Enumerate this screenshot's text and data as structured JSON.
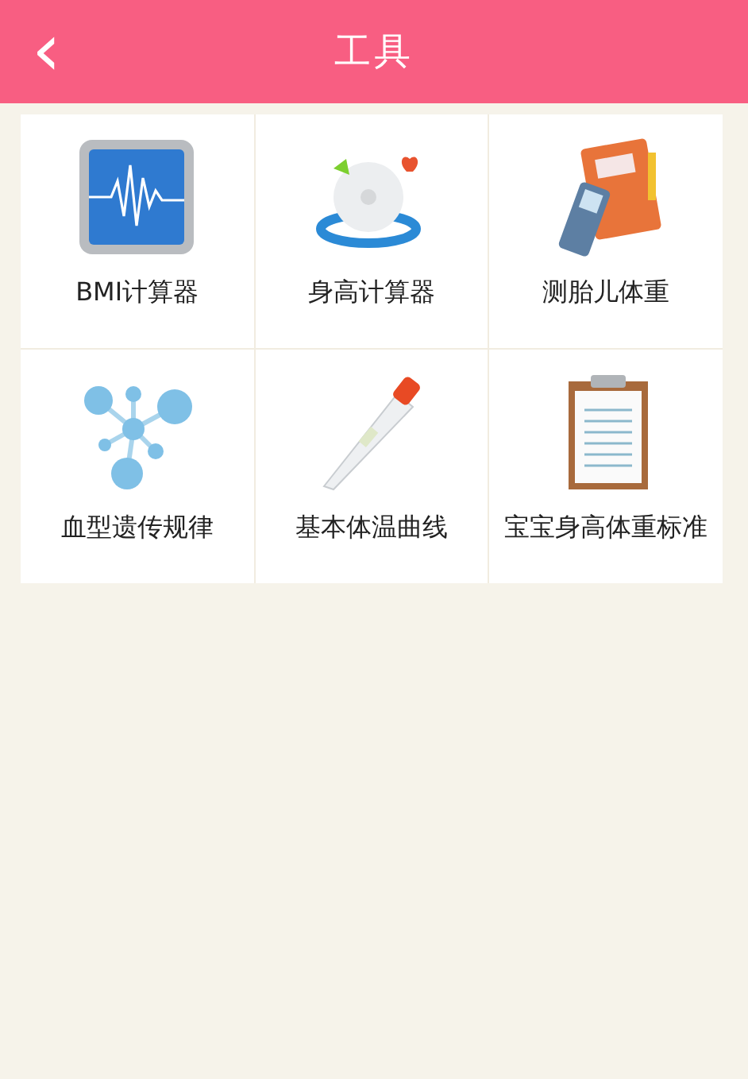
{
  "header": {
    "back_icon": "‹",
    "title": "工具"
  },
  "tools": [
    {
      "label": "BMI计算器"
    },
    {
      "label": "身高计算器"
    },
    {
      "label": "测胎儿体重"
    },
    {
      "label": "血型遗传规律"
    },
    {
      "label": "基本体温曲线"
    },
    {
      "label": "宝宝身高体重标准"
    }
  ]
}
